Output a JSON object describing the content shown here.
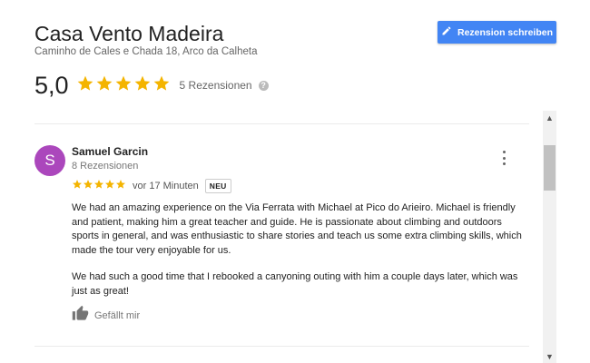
{
  "place": {
    "name": "Casa Vento Madeira",
    "address": "Caminho de Cales e Chada 18, Arco da Calheta"
  },
  "header": {
    "write_review_label": "Rezension schreiben",
    "write_review_icon": "pencil-icon",
    "accent_color": "#4285f4"
  },
  "summary": {
    "rating": "5,0",
    "stars": 5,
    "review_count_text": "5 Rezensionen",
    "help_symbol": "?",
    "star_color": "#f4b400"
  },
  "review": {
    "avatar_letter": "S",
    "avatar_color": "#ab47bc",
    "author": "Samuel Garcin",
    "author_meta": "8 Rezensionen",
    "stars": 5,
    "time": "vor 17 Minuten",
    "badge": "NEU",
    "paragraphs": [
      "We had an amazing experience on the Via Ferrata with Michael at Pico do Arieiro. Michael is friendly and patient, making him a great teacher and guide. He is passionate about climbing and outdoors sports in general, and was enthusiastic to share stories and teach us some extra climbing skills, which made the tour very enjoyable for us.",
      "We had such a good time that I rebooked a canyoning outing with him a couple days later, which was just as great!"
    ],
    "like_label": "Gefällt mir",
    "like_icon": "thumbs-up-icon",
    "more_icon": "more-vert-icon"
  },
  "scrollbar": {
    "up_symbol": "▲",
    "down_symbol": "▼"
  }
}
